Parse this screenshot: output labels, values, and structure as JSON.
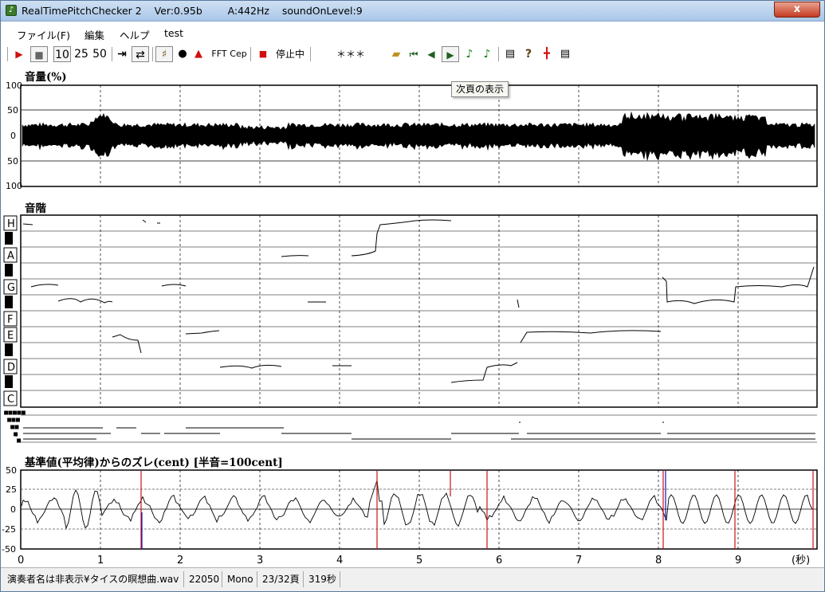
{
  "window": {
    "title": "RealTimePitchChecker 2    Ver:0.95b        A:442Hz    soundOnLevel:9",
    "close": "x"
  },
  "menu": [
    {
      "label": "ファイル(F)"
    },
    {
      "label": "編集"
    },
    {
      "label": "ヘルプ"
    },
    {
      "label": "test"
    }
  ],
  "toolbar": {
    "play": "▶",
    "stop": "■",
    "n10": "10",
    "n25": "25",
    "n50": "50",
    "fft": "FFT",
    "cep": "Cep",
    "status": "停止中",
    "stars": "＊＊＊",
    "icons": [
      "play-icon",
      "stop-icon",
      "jump-end-icon",
      "repeat-icon",
      "violin-icon",
      "person-black-icon",
      "person-red-icon",
      "record-icon",
      "open-folder-icon",
      "first-page-icon",
      "prev-page-icon",
      "next-page-icon",
      "note-icon",
      "note-alt-icon",
      "print-icon",
      "help-icon",
      "marker-icon",
      "printer-icon"
    ]
  },
  "tooltip": "次頁の表示",
  "volume": {
    "label": "音量(%)",
    "y_labels": [
      "100",
      "50",
      "0",
      "50",
      "100"
    ]
  },
  "scale": {
    "label": "音階",
    "notes": [
      "H",
      "A",
      "G",
      "F",
      "E",
      "D",
      "C"
    ]
  },
  "deviation": {
    "label": "基準値(平均律)からのズレ(cent) [半音=100cent]",
    "y_labels": [
      "50",
      "25",
      "0",
      "-25",
      "-50"
    ]
  },
  "time_axis": {
    "ticks": [
      "0",
      "1",
      "2",
      "3",
      "4",
      "5",
      "6",
      "7",
      "8",
      "9"
    ],
    "unit": "(秒)"
  },
  "status": {
    "file": "演奏者名は非表示¥タイスの瞑想曲.wav",
    "rate": "22050",
    "channels": "Mono",
    "page": "23/32頁",
    "duration": "319秒"
  },
  "colors": {
    "red_marker": "#d01010",
    "blue_marker": "#1010c0"
  }
}
